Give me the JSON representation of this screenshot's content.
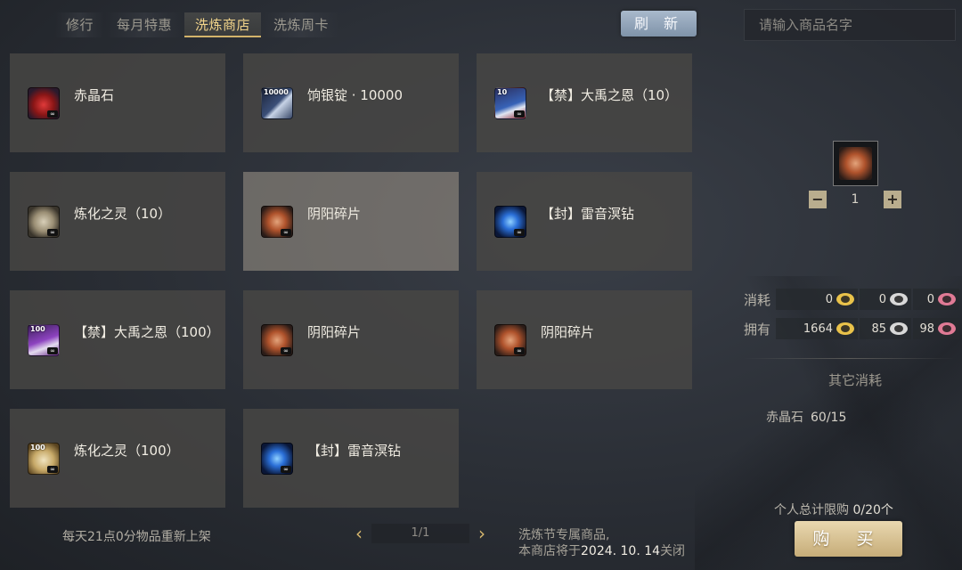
{
  "tabs": [
    {
      "label": "修行"
    },
    {
      "label": "每月特惠"
    },
    {
      "label": "洗炼商店"
    },
    {
      "label": "洗炼周卡"
    }
  ],
  "active_tab": 2,
  "refresh_label": "刷 新",
  "search": {
    "placeholder": "请输入商品名字",
    "value": ""
  },
  "items": [
    {
      "name": "赤晶石",
      "icon": "red-crystal-icon",
      "badge": ""
    },
    {
      "name": "饷银锭 · 10000",
      "icon": "silver-ingot-icon",
      "badge": "10000"
    },
    {
      "name": "【禁】大禹之恩（10）",
      "icon": "scroll-book-icon",
      "badge": "10"
    },
    {
      "name": "炼化之灵（10）",
      "icon": "refine-orb-icon",
      "badge": ""
    },
    {
      "name": "阴阳碎片",
      "icon": "yinyang-shard-icon",
      "badge": ""
    },
    {
      "name": "【封】雷音溟钻",
      "icon": "thunder-gem-icon",
      "badge": ""
    },
    {
      "name": "【禁】大禹之恩（100）",
      "icon": "scroll-book-icon",
      "badge": "100"
    },
    {
      "name": "阴阳碎片",
      "icon": "yinyang-shard-icon",
      "badge": ""
    },
    {
      "name": "阴阳碎片",
      "icon": "yinyang-shard-icon",
      "badge": ""
    },
    {
      "name": "炼化之灵（100）",
      "icon": "refine-orb-icon",
      "badge": "100"
    },
    {
      "name": "【封】雷音溟钻",
      "icon": "thunder-gem-icon",
      "badge": ""
    }
  ],
  "selected_item": 4,
  "footer": {
    "restock_text": "每天21点0分物品重新上架",
    "page": "1/1",
    "notice_line1": "洗炼节专属商品,",
    "notice_line2_prefix": "本商店将于",
    "notice_date": "2024. 10. 14",
    "notice_line2_suffix": "关闭"
  },
  "detail": {
    "quantity": "1",
    "minus": "−",
    "plus": "+",
    "cost_label": "消耗",
    "own_label": "拥有",
    "cost_values": [
      "0",
      "0",
      "0"
    ],
    "own_values": [
      "1664",
      "85",
      "98"
    ],
    "currency_icons": [
      "gold-coin-icon",
      "silver-coin-icon",
      "pink-coin-icon"
    ],
    "other_title": "其它消耗",
    "other_item": "赤晶石",
    "other_value": "60/15",
    "limit_label": "个人总计限购",
    "limit_value": "0/20个",
    "buy_label": "购 买"
  },
  "colors": {
    "accent_gold": "#d3b36a",
    "refresh_blue": "#8ea2b8",
    "buy_gold": "#d8c190"
  }
}
